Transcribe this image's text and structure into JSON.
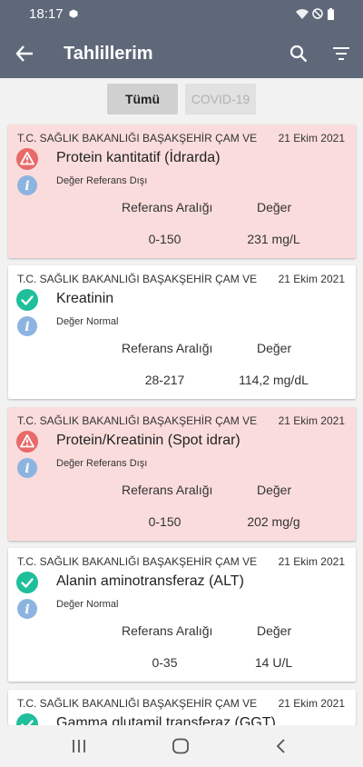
{
  "status_bar": {
    "time": "18:17"
  },
  "app_bar": {
    "title": "Tahlillerim"
  },
  "filters": {
    "all_label": "Tümü",
    "covid_label": "COVID-19"
  },
  "labels": {
    "reference_range": "Referans Aralığı",
    "value": "Değer"
  },
  "colors": {
    "header_bg": "#5e6879",
    "abnormal_card": "#fbdcdc",
    "normal_card": "#ffffff",
    "warning_red": "#e86a6a",
    "ok_green": "#1fbf9b",
    "info_blue": "#8db4e0"
  },
  "results": [
    {
      "status": "abnormal",
      "icon": "warning-icon",
      "institution": "T.C. SAĞLIK BAKANLIĞI BAŞAKŞEHİR ÇAM VE",
      "date": "21 Ekim 2021",
      "test": "Protein kantitatif (İdrarda)",
      "result_status": "Değer Referans Dışı",
      "reference": "0-150",
      "value": "231 mg/L"
    },
    {
      "status": "normal",
      "icon": "check-icon",
      "institution": "T.C. SAĞLIK BAKANLIĞI BAŞAKŞEHİR ÇAM VE",
      "date": "21 Ekim 2021",
      "test": "Kreatinin",
      "result_status": "Değer Normal",
      "reference": "28-217",
      "value": "114,2 mg/dL"
    },
    {
      "status": "abnormal",
      "icon": "warning-icon",
      "institution": "T.C. SAĞLIK BAKANLIĞI BAŞAKŞEHİR ÇAM VE",
      "date": "21 Ekim 2021",
      "test": "Protein/Kreatinin (Spot idrar)",
      "result_status": "Değer Referans Dışı",
      "reference": "0-150",
      "value": "202 mg/g"
    },
    {
      "status": "normal",
      "icon": "check-icon",
      "institution": "T.C. SAĞLIK BAKANLIĞI BAŞAKŞEHİR ÇAM VE",
      "date": "21 Ekim 2021",
      "test": "Alanin aminotransferaz (ALT)",
      "result_status": "Değer Normal",
      "reference": "0-35",
      "value": "14 U/L"
    },
    {
      "status": "normal",
      "icon": "check-icon",
      "institution": "T.C. SAĞLIK BAKANLIĞI BAŞAKŞEHİR ÇAM VE",
      "date": "21 Ekim 2021",
      "test": "Gamma glutamil transferaz (GGT)"
    }
  ]
}
